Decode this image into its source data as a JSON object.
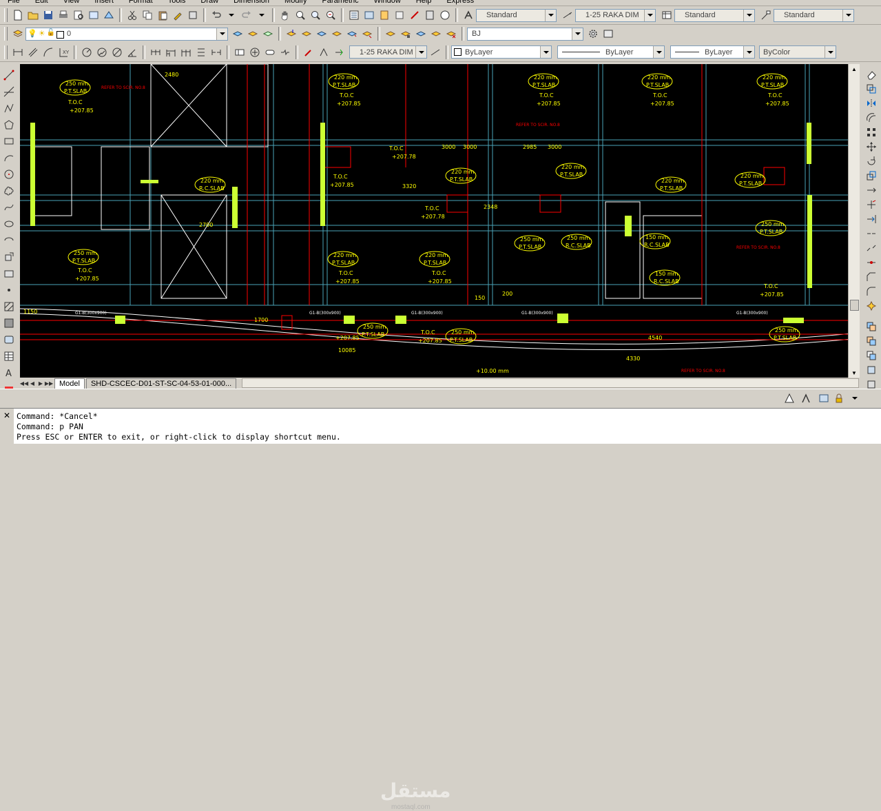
{
  "menubar": {
    "items": [
      "File",
      "Edit",
      "View",
      "Insert",
      "Format",
      "Tools",
      "Draw",
      "Dimension",
      "Modify",
      "Parametric",
      "Window",
      "Help",
      "Express"
    ]
  },
  "styles_toolbar": {
    "text_style": "Standard",
    "dim_style": "1-25 RAKA DIM",
    "table_style": "Standard",
    "multileader_style": "Standard"
  },
  "layer_toolbar": {
    "current_layer": "0",
    "workspace": "BJ"
  },
  "properties_toolbar": {
    "dim_style": "1-25 RAKA DIM",
    "color": "ByLayer",
    "linetype": "ByLayer",
    "lineweight": "ByLayer",
    "plotstyle": "ByColor"
  },
  "layout_tabs": {
    "model": "Model",
    "layout": "SHD-CSCEC-D01-ST-SC-04-53-01-000..."
  },
  "watermark": {
    "text": "مستقل",
    "sub": "mostaql.com"
  },
  "command_line": {
    "line1": "Command: *Cancel*",
    "line2": "Command: p PAN",
    "line3": "Press ESC or ENTER to exit, or right-click to display shortcut menu."
  },
  "drawing": {
    "slab_label_220": "220 mm.",
    "slab_label_250": "250 mm.",
    "slab_label_150": "150 mm.",
    "pt_slab": "P.T.SLAB",
    "rc_slab": "R.C.SLAB",
    "toc": "T.O.C",
    "level_785": "+207.85",
    "level_778": "+207.78",
    "level_10": "+10.00 mm",
    "dim_3000": "3000",
    "dim_2985": "2985",
    "dim_3320": "3320",
    "dim_2348": "2348",
    "dim_2700": "2700",
    "dim_2480": "2480",
    "dim_10085": "10085",
    "dim_1150": "1150",
    "dim_1700": "1700",
    "dim_200": "200",
    "dim_150": "150",
    "dim_4540": "4540",
    "dim_4330": "4330",
    "refer_note": "REFER TO SCIR. NO.8",
    "beam_ref": "G1-B(300x900)",
    "colors": {
      "yellow": "#ffff00",
      "cyan": "#00ffff",
      "red": "#ff0000",
      "white": "#ffffff",
      "green": "#ccff33",
      "magenta": "#ff00ff",
      "grid": "#4aa3b8"
    }
  }
}
